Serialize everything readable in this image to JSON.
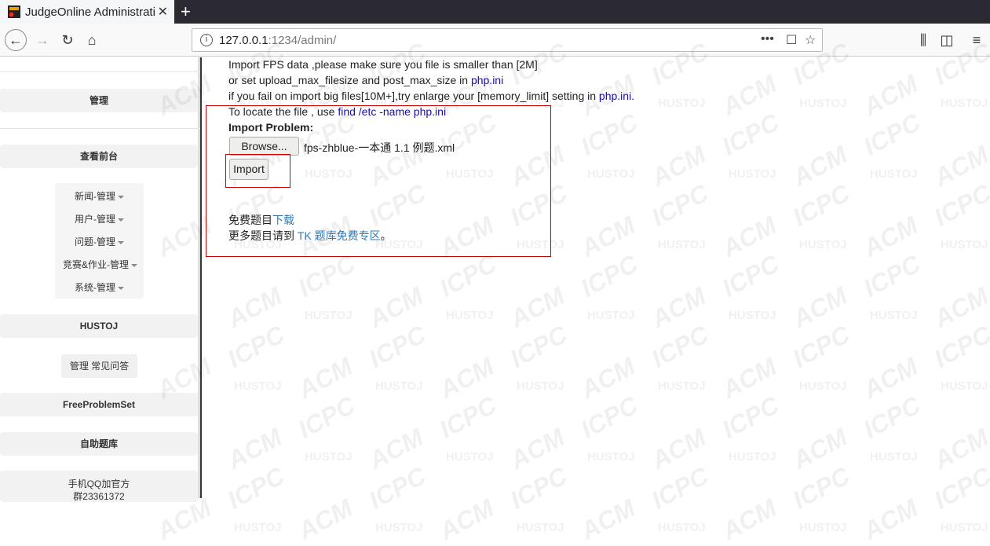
{
  "browser": {
    "tab_title": "JudgeOnline Administration",
    "url_host": "127.0.0.1",
    "url_rest": ":1234/admin/"
  },
  "sidebar": {
    "manage": "管理",
    "view_front": "查看前台",
    "menu": [
      {
        "label": "新闻-管理"
      },
      {
        "label": "用户-管理"
      },
      {
        "label": "问题-管理"
      },
      {
        "label": "竞赛&作业-管理"
      },
      {
        "label": "系统-管理"
      }
    ],
    "hustoj": "HUSTOJ",
    "faq": "管理 常见问答",
    "fps": "FreeProblemSet",
    "self_bank": "自助题库",
    "qq_line1": "手机QQ加官方",
    "qq_line2": "群23361372"
  },
  "main": {
    "line1": "Import FPS data ,please make sure you file is smaller than [2M]",
    "line2_text": "or set upload_max_filesize and post_max_size in ",
    "line2_link": "php.ini",
    "line3_text": "if you fail on import big files[10M+],try enlarge your [memory_limit] setting in ",
    "line3_link": "php.ini.",
    "line4_text": "To locate the file , use ",
    "line4_link": "find /etc -name php.ini",
    "import_problem": "Import Problem:",
    "browse_label": "Browse...",
    "file_name": "fps-zhblue-一本通 1.1 例题.xml",
    "import_label": "Import",
    "free_text": "免费题目",
    "free_link": "下载",
    "more_text": "更多题目请到 ",
    "more_link": "TK 题库免费专区",
    "more_end": "。"
  },
  "watermark": {
    "acm": "ACM",
    "icpc": "ICPC",
    "hustoj": "HUSTOJ"
  }
}
